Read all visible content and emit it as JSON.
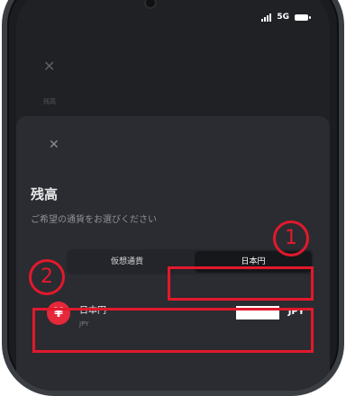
{
  "status": {
    "network": "5G"
  },
  "background": {
    "label": "残高"
  },
  "sheet": {
    "title": "残高",
    "subtitle": "ご希望の通貨をお選びください",
    "tabs": [
      {
        "label": "仮想通貨",
        "selected": false
      },
      {
        "label": "日本円",
        "selected": true
      }
    ],
    "item": {
      "icon_symbol": "¥",
      "name": "日本円",
      "code": "JPY",
      "amount_currency": "JPY"
    }
  },
  "annotations": {
    "step1": "1",
    "step2": "2",
    "color": "#e2192c"
  }
}
